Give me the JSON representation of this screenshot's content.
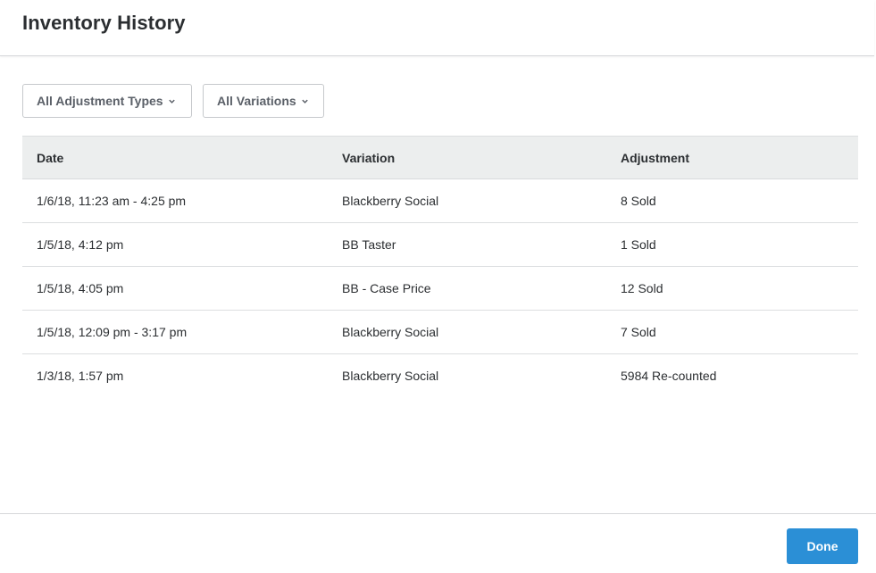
{
  "header": {
    "title": "Inventory History"
  },
  "filters": {
    "adjustment_types_label": "All Adjustment Types",
    "variations_label": "All Variations"
  },
  "table": {
    "columns": [
      "Date",
      "Variation",
      "Adjustment"
    ],
    "rows": [
      {
        "date": "1/6/18, 11:23 am - 4:25 pm",
        "variation": "Blackberry Social",
        "adjustment": "8 Sold"
      },
      {
        "date": "1/5/18, 4:12 pm",
        "variation": "BB Taster",
        "adjustment": "1 Sold"
      },
      {
        "date": "1/5/18, 4:05 pm",
        "variation": "BB - Case Price",
        "adjustment": "12 Sold"
      },
      {
        "date": "1/5/18, 12:09 pm - 3:17 pm",
        "variation": "Blackberry Social",
        "adjustment": "7 Sold"
      },
      {
        "date": "1/3/18, 1:57 pm",
        "variation": "Blackberry Social",
        "adjustment": "5984 Re-counted"
      }
    ]
  },
  "footer": {
    "done_label": "Done"
  },
  "colors": {
    "accent": "#2b8fd6",
    "header_bg": "#eceeee",
    "text": "#2b2e31",
    "muted_text": "#5b6068"
  },
  "icons": {
    "dropdown": "chevron-down-icon"
  }
}
